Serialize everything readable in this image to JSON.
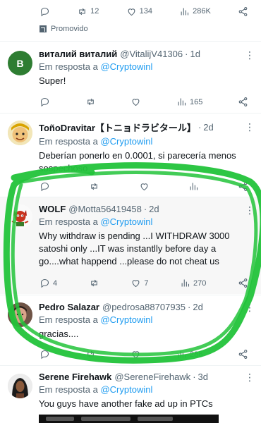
{
  "top_actions": {
    "retweets": "12",
    "likes": "134",
    "views": "286K"
  },
  "promoted_label": "Promovido",
  "tweets": [
    {
      "name": "виталий виталий",
      "handle": "@VitalijV41306",
      "time": "1d",
      "reply_prefix": "Em resposta a",
      "reply_to": "@Cryptowinl",
      "text": "Super!",
      "replies": "",
      "retweets": "",
      "likes": "",
      "views": "165",
      "avatar_letter": "B",
      "avatar_color": "#2e7d32"
    },
    {
      "name": "ToñoDravitar【トニョドラビタール】",
      "handle": "",
      "time": "2d",
      "reply_prefix": "Em resposta a",
      "reply_to": "@Cryptowinl",
      "text": "Deberían ponerlo en 0.0001, si parecería menos sospechoso",
      "replies": "",
      "retweets": "",
      "likes": "",
      "views": ""
    },
    {
      "name": "WOLF",
      "handle": "@Motta56419458",
      "time": "2d",
      "reply_prefix": "Em resposta a",
      "reply_to": "@Cryptowinl",
      "text": "Why withdraw is pending ...I WITHDRAW 3000 satoshi only ...IT was instantlly before day a go....what happend ...please do not cheat us",
      "replies": "4",
      "retweets": "",
      "likes": "7",
      "views": "270"
    },
    {
      "name": "Pedro Salazar",
      "handle": "@pedrosa88707935",
      "time": "2d",
      "reply_prefix": "Em resposta a",
      "reply_to": "@Cryptowinl",
      "text": "gracias....",
      "replies": "",
      "retweets": "",
      "likes": "",
      "views": "286"
    },
    {
      "name": "Serene Firehawk",
      "handle": "@SereneFirehawk",
      "time": "3d",
      "reply_prefix": "Em resposta a",
      "reply_to": "@Cryptowinl",
      "text": "You guys have another fake ad up in PTCs"
    }
  ],
  "colors": {
    "link": "#1d9bf0",
    "muted": "#536471",
    "annotation": "#22c33a",
    "highlight_bg": "#f7f7f7"
  },
  "icons": [
    "reply-icon",
    "retweet-icon",
    "like-icon",
    "views-icon",
    "share-icon",
    "more-icon",
    "promoted-icon"
  ]
}
